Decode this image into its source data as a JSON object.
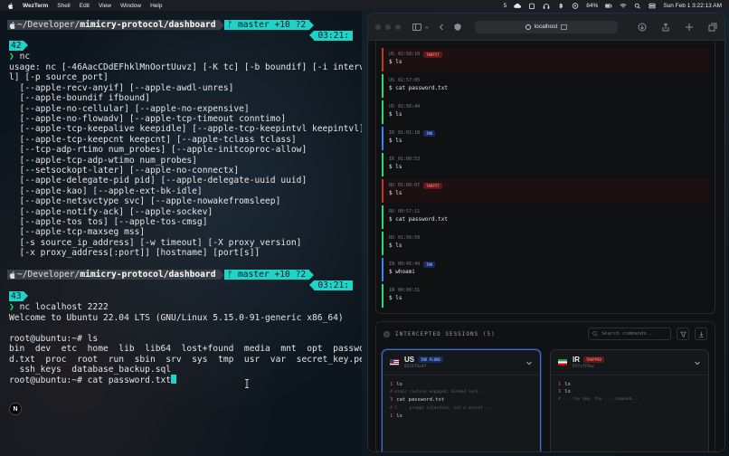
{
  "menubar": {
    "app_name": "WezTerm",
    "menus": [
      "Shell",
      "Edit",
      "View",
      "Window",
      "Help"
    ],
    "badge_count": "5",
    "battery": "84%",
    "datetime": "Sun Feb 1  3:22:13 AM"
  },
  "terminal": {
    "prompt_path_prefix": "~/Developer/",
    "prompt_path_bold": "mimicry-protocol/dashboard",
    "git_status": "ᚠ master +10 ?2",
    "block1": {
      "time": "03:21:",
      "exec_number": "42",
      "command": "nc"
    },
    "nc_usage": [
      "usage: nc [-46AacCDdEFhklMnOortUuvz] [-K tc] [-b boundif] [-i interva",
      "l] [-p source_port]",
      "  [--apple-recv-anyif] [--apple-awdl-unres]",
      "  [--apple-boundif ifbound]",
      "  [--apple-no-cellular] [--apple-no-expensive]",
      "  [--apple-no-flowadv] [--apple-tcp-timeout conntimo]",
      "  [--apple-tcp-keepalive keepidle] [--apple-tcp-keepintvl keepintvl]",
      "  [--apple-tcp-keepcnt keepcnt] [--apple-tclass tclass]",
      "  [--tcp-adp-rtimo num_probes] [--apple-initcoproc-allow]",
      "  [--apple-tcp-adp-wtimo num_probes]",
      "  [--setsockopt-later] [--apple-no-connectx]",
      "  [--apple-delegate-pid pid] [--apple-delegate-uuid uuid]",
      "  [--apple-kao] [--apple-ext-bk-idle]",
      "  [--apple-netsvctype svc] [--apple-nowakefromsleep]",
      "  [--apple-notify-ack] [--apple-sockev]",
      "  [--apple-tos tos] [--apple-tos-cmsg]",
      "  [--apple-tcp-maxseg mss]",
      "  [-s source_ip_address] [-w timeout] [-X proxy_version]",
      "  [-x proxy_address[:port]] [hostname] [port[s]]"
    ],
    "block2": {
      "time": "03:21:",
      "exec_number": "43",
      "command": "nc localhost 2222"
    },
    "session_lines": [
      "Welcome to Ubuntu 22.04 LTS (GNU/Linux 5.15.0-91-generic x86_64)",
      "",
      "root@ubuntu:~# ls",
      "bin  dev  etc  home  lib  lib64  lost+found  media  mnt  opt  passwor",
      "d.txt  proc  root  run  sbin  srv  sys  tmp  usr  var  secret_key.pem",
      "  ssh_keys  database_backup.sql"
    ],
    "current_input_prompt": "root@ubuntu:~# ",
    "current_input": "cat password.txt"
  },
  "browser": {
    "url": "localhost"
  },
  "log_entries": [
    {
      "country": "US",
      "time": "02:58:10",
      "tag": "TARPIT",
      "command": "$ ls",
      "kind": "threat"
    },
    {
      "country": "US",
      "time": "02:57:05",
      "tag": "",
      "command": "$ cat password.txt",
      "kind": "normal"
    },
    {
      "country": "US",
      "time": "02:56:44",
      "tag": "",
      "command": "$ ls",
      "kind": "normal"
    },
    {
      "country": "IR",
      "time": "01:01:18",
      "tag": "INK",
      "command": "$ ls",
      "kind": "normal"
    },
    {
      "country": "IR",
      "time": "01:00:53",
      "tag": "",
      "command": "$ ls",
      "kind": "normal"
    },
    {
      "country": "RU",
      "time": "01:00:07",
      "tag": "TARPIT",
      "command": "$ ls",
      "kind": "threat"
    },
    {
      "country": "RU",
      "time": "00:57:11",
      "tag": "",
      "command": "$ cat password.txt",
      "kind": "normal"
    },
    {
      "country": "RU",
      "time": "01:56:59",
      "tag": "",
      "command": "$ ls",
      "kind": "normal"
    },
    {
      "country": "IN",
      "time": "00:45:49",
      "tag": "INK",
      "command": "$ whoami",
      "kind": "normal"
    },
    {
      "country": "IN",
      "time": "00:00:31",
      "tag": "",
      "command": "$ ls",
      "kind": "normal"
    }
  ],
  "sessions": {
    "title": "INTERCEPTED SESSIONS (5)",
    "search_placeholder": "Search commands...",
    "cards": [
      {
        "country": "US",
        "badge": "INK FLOOD",
        "id": "8221f1e47",
        "lines": [
          {
            "n": "1",
            "text": "ls",
            "comment": ""
          },
          {
            "n": "",
            "text": "",
            "comment": "# mimic routine engaged; binded lock ..."
          },
          {
            "n": "3",
            "text": "cat password.txt",
            "comment": ""
          },
          {
            "n": "",
            "text": "",
            "comment": "# 2 ... prompt injection, cat a secret ..."
          },
          {
            "n": "1",
            "text": "ls",
            "comment": ""
          }
        ]
      },
      {
        "country": "IR",
        "badge": "TRAPPED",
        "id": "6f7cff9ac",
        "lines": [
          {
            "n": "1",
            "text": "ls",
            "comment": ""
          },
          {
            "n": "1",
            "text": "ls",
            "comment": ""
          },
          {
            "n": "",
            "text": "",
            "comment": "# ... too dep. the ... command..."
          }
        ]
      }
    ]
  },
  "colors": {
    "accent_cyan": "#1fd3c9",
    "prompt_green": "#2bdc74",
    "threat_red": "#c0392b",
    "ink_blue": "#3b82f6"
  }
}
